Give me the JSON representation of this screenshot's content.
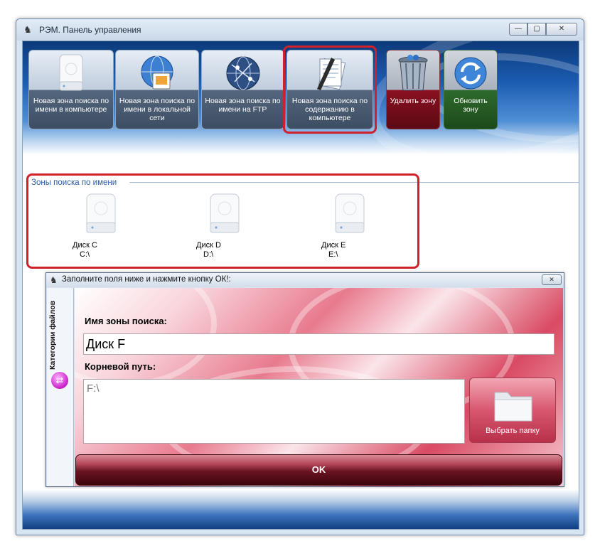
{
  "window": {
    "title": "РЭМ. Панель управления",
    "controls": {
      "minimize": "—",
      "maximize": "▢",
      "close": "✕"
    }
  },
  "toolbar": {
    "buttons": [
      {
        "label": "Новая зона поиска по имени в компьютере",
        "icon": "hard-disk-icon"
      },
      {
        "label": "Новая зона поиска по имени в локальной сети",
        "icon": "network-globe-icon"
      },
      {
        "label": "Новая зона поиска по имени на FTP",
        "icon": "ftp-globe-icon"
      },
      {
        "label": "Новая зона поиска по содержанию в компьютере",
        "icon": "document-pen-icon"
      },
      {
        "label": "Удалить зону",
        "icon": "trash-bin-icon"
      },
      {
        "label": "Обновить зону",
        "icon": "refresh-icon"
      }
    ]
  },
  "zones": {
    "title": "Зоны поиска по имени",
    "disks": [
      {
        "name": "Диск C",
        "path": "C:\\"
      },
      {
        "name": "Диск D",
        "path": "D:\\"
      },
      {
        "name": "Диск E",
        "path": "E:\\"
      }
    ]
  },
  "dialog": {
    "title": "Заполните поля ниже и нажмите кнопку ОК!:",
    "side_tab": "Категории файлов",
    "name_label": "Имя зоны поиска:",
    "name_value": "Диск F",
    "path_label": "Корневой путь:",
    "path_value": "F:\\",
    "folder_button": "Выбрать папку",
    "ok_button": "OK"
  },
  "colors": {
    "highlight": "#d0202a",
    "toolbar_blue": "#1b5bb0",
    "dialog_pink": "#e87a8e",
    "ok_dark_red": "#6a1321"
  }
}
